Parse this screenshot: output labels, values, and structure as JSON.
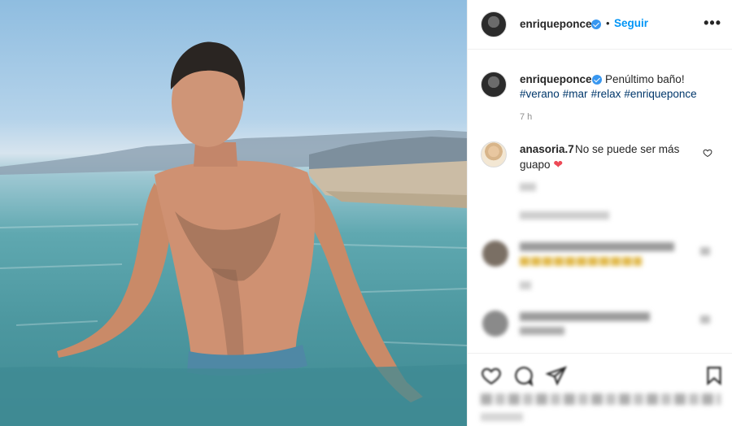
{
  "post": {
    "author": "enriqueponce",
    "follow_label": "Seguir",
    "separator": "•",
    "more_label": "•••",
    "caption_text": "Penúltimo baño!",
    "hashtags": [
      "#verano",
      "#mar",
      "#relax",
      "#enriqueponce"
    ],
    "time_ago": "7 h"
  },
  "comments": [
    {
      "user": "anasoria.7",
      "text_line1": "No se puede ser más",
      "text_line2": "guapo",
      "emoji": "❤"
    }
  ],
  "icons": {
    "verified": "verified-badge-icon",
    "like": "heart-icon",
    "comment": "comment-bubble-icon",
    "share": "paper-plane-icon",
    "save": "bookmark-icon"
  },
  "colors": {
    "accent": "#0095f6",
    "verified": "#3897f0",
    "hashtag": "#00376b",
    "heart": "#ed4956"
  }
}
